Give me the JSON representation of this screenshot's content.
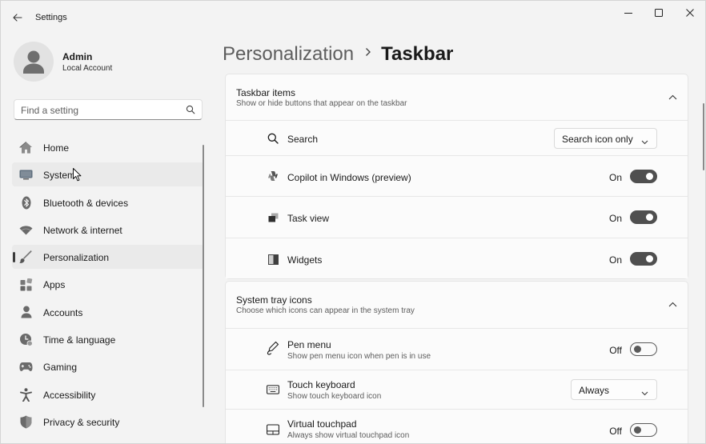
{
  "window": {
    "title": "Settings"
  },
  "user": {
    "name": "Admin",
    "account_type": "Local Account"
  },
  "search": {
    "placeholder": "Find a setting"
  },
  "sidebar": {
    "items": [
      {
        "label": "Home",
        "icon": "home-icon"
      },
      {
        "label": "System",
        "icon": "system-icon"
      },
      {
        "label": "Bluetooth & devices",
        "icon": "bluetooth-icon"
      },
      {
        "label": "Network & internet",
        "icon": "wifi-icon"
      },
      {
        "label": "Personalization",
        "icon": "brush-icon",
        "selected": true
      },
      {
        "label": "Apps",
        "icon": "apps-icon"
      },
      {
        "label": "Accounts",
        "icon": "person-icon"
      },
      {
        "label": "Time & language",
        "icon": "clock-globe-icon"
      },
      {
        "label": "Gaming",
        "icon": "gamepad-icon"
      },
      {
        "label": "Accessibility",
        "icon": "accessibility-icon"
      },
      {
        "label": "Privacy & security",
        "icon": "shield-icon"
      }
    ]
  },
  "breadcrumb": {
    "parent": "Personalization",
    "separator": "›",
    "current": "Taskbar"
  },
  "taskbar_items": {
    "title": "Taskbar items",
    "subtitle": "Show or hide buttons that appear on the taskbar",
    "rows": [
      {
        "label": "Search",
        "icon": "search-icon",
        "control": "dropdown",
        "value": "Search icon only"
      },
      {
        "label": "Copilot in Windows (preview)",
        "icon": "copilot-icon",
        "control": "toggle",
        "state": "On"
      },
      {
        "label": "Task view",
        "icon": "task-view-icon",
        "control": "toggle",
        "state": "On"
      },
      {
        "label": "Widgets",
        "icon": "widgets-icon",
        "control": "toggle",
        "state": "On"
      }
    ]
  },
  "system_tray": {
    "title": "System tray icons",
    "subtitle": "Choose which icons can appear in the system tray",
    "rows": [
      {
        "label": "Pen menu",
        "sub": "Show pen menu icon when pen is in use",
        "icon": "pen-icon",
        "control": "toggle",
        "state": "Off"
      },
      {
        "label": "Touch keyboard",
        "sub": "Show touch keyboard icon",
        "icon": "keyboard-icon",
        "control": "dropdown",
        "value": "Always"
      },
      {
        "label": "Virtual touchpad",
        "sub": "Always show virtual touchpad icon",
        "icon": "touchpad-icon",
        "control": "toggle",
        "state": "Off"
      }
    ]
  },
  "colors": {
    "background": "#f3f3f3",
    "card": "#fbfbfb",
    "toggle_on": "#4f4f4f",
    "text": "#1a1a1a",
    "secondary_text": "#5d5d5d"
  }
}
